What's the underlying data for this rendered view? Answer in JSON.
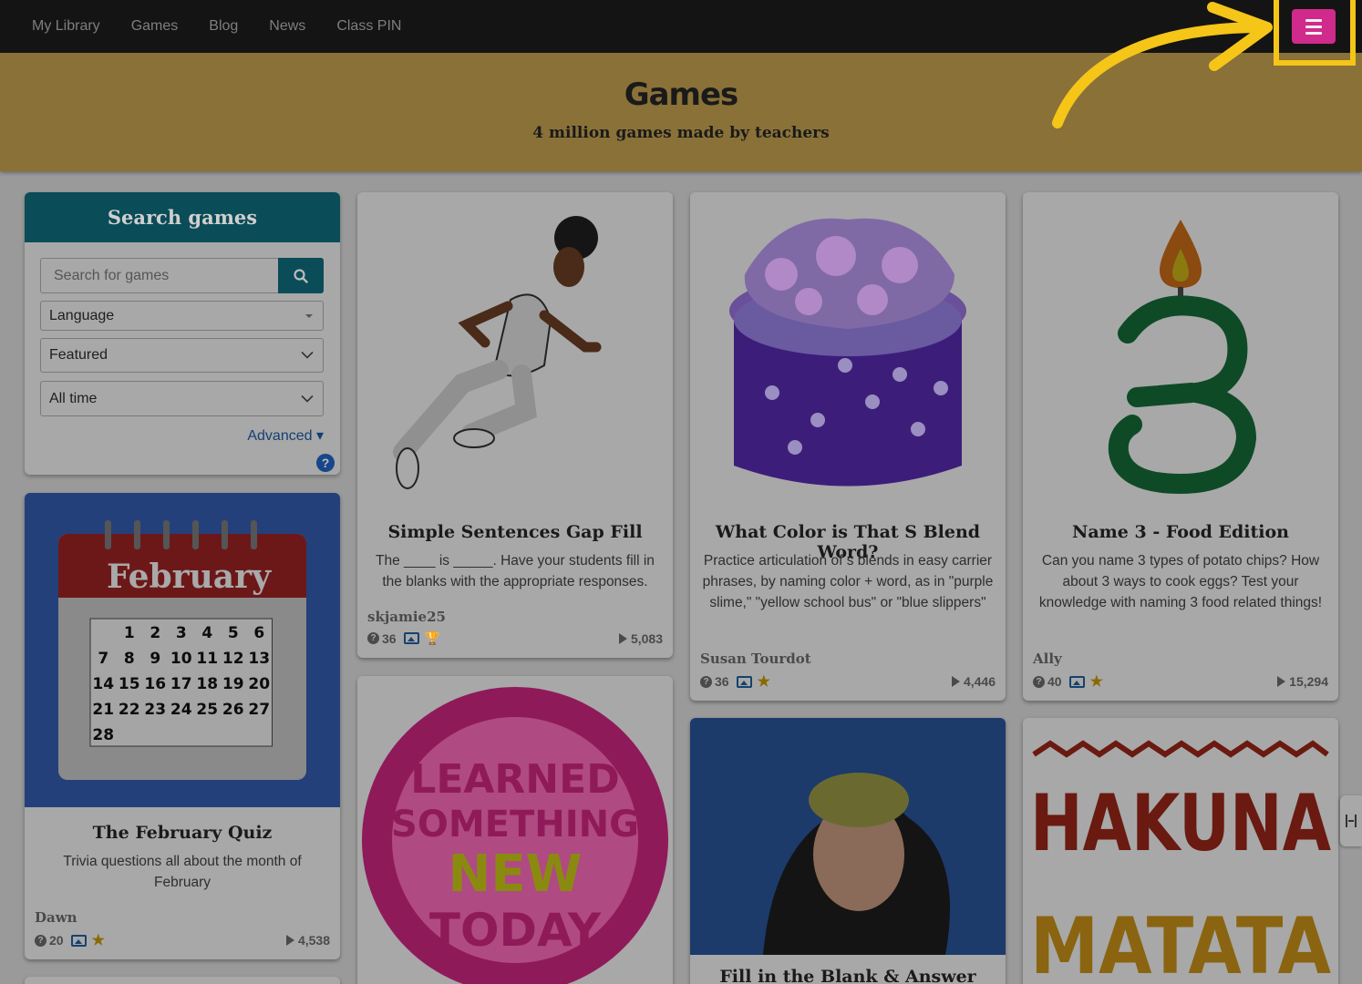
{
  "nav": {
    "items": [
      "My Library",
      "Games",
      "Blog",
      "News",
      "Class PIN"
    ],
    "menu_icon": "hamburger-icon"
  },
  "hero": {
    "title": "Games",
    "subtitle": "4 million games made by teachers"
  },
  "search": {
    "heading": "Search games",
    "placeholder": "Search for games",
    "language": "Language",
    "sort": "Featured",
    "time": "All time",
    "advanced": "Advanced ▾",
    "help": "?"
  },
  "cards": [
    {
      "title": "Simple Sentences Gap Fill",
      "desc": "The ____ is _____. Have your students fill in the blanks with the appropriate responses.",
      "author": "skjamie25",
      "questions": "36",
      "plays": "5,083",
      "badge": "trophy-icon"
    },
    {
      "title": "What Color is That S Blend Word?",
      "desc": "Practice articulation of s blends in easy carrier phrases, by naming color + word, as in \"purple slime,\" \"yellow school bus\" or \"blue slippers\"",
      "author": "Susan Tourdot",
      "questions": "36",
      "plays": "4,446",
      "badge": "star-icon"
    },
    {
      "title": "Name 3 - Food Edition",
      "desc": "Can you name 3 types of potato chips? How about 3 ways to cook eggs? Test your knowledge with naming 3 food related things!",
      "author": "Ally",
      "questions": "40",
      "plays": "15,294",
      "badge": "star-icon"
    },
    {
      "title": "The February Quiz",
      "desc": "Trivia questions all about the month of February",
      "author": "Dawn",
      "questions": "20",
      "plays": "4,538",
      "badge": "star-icon"
    },
    {
      "title": "Fill in the Blank & Answer"
    }
  ],
  "art": {
    "calendar_month": "February",
    "calendar_days": [
      "1",
      "2",
      "3",
      "4",
      "5",
      "6",
      "7",
      "8",
      "9",
      "10",
      "11",
      "12",
      "13",
      "14",
      "15",
      "16",
      "17",
      "18",
      "19",
      "20",
      "21",
      "22",
      "23",
      "24",
      "25",
      "26",
      "27",
      "28"
    ],
    "badge_lines": [
      "LEARNED",
      "SOMETHING",
      "NEW",
      "TODAY"
    ],
    "hakuna": "HAKUNA",
    "matata": "MATATA",
    "big_number": "3"
  },
  "colors": {
    "nav_bg": "#141414",
    "hero_bg": "#8a7138",
    "accent_teal": "#0a4c58",
    "menu_pink": "#d02a8c",
    "highlight_yellow": "#f5c518"
  }
}
